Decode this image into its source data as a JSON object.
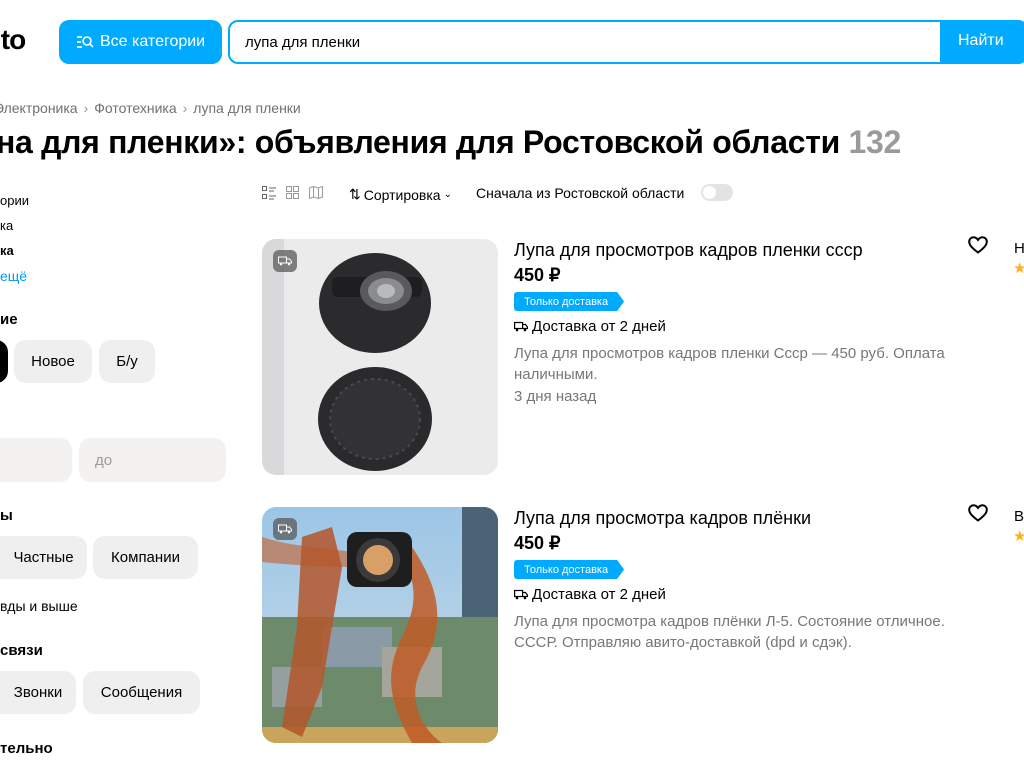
{
  "header": {
    "logo_text": "ito",
    "categories_label": "Все категории",
    "search_value": "лупа для пленки",
    "search_button": "Найти",
    "accent_color": "#00aaff"
  },
  "breadcrumbs": [
    "Электроника",
    "Фототехника",
    "лупа для пленки"
  ],
  "page_title": {
    "text": "на для пленки»: объявления для Ростовской области",
    "count": "132"
  },
  "sidebar": {
    "category_lines": [
      "ории",
      "ка",
      "ка"
    ],
    "show_more": "ещё",
    "condition_heading": "ие",
    "condition_chips": [
      "Новое",
      "Б/у"
    ],
    "price_to_placeholder": "до",
    "sellers_heading": "ы",
    "seller_chips": [
      "Частные",
      "Компании"
    ],
    "rating_text": "вды и выше",
    "contact_heading": "связи",
    "contact_chips": [
      "Звонки",
      "Сообщения"
    ],
    "bottom_heading": "тельно"
  },
  "toolbar": {
    "sort_label": "Сортировка",
    "region_label": "Сначала из Ростовской области",
    "icons": [
      "list-view-icon",
      "grid-view-icon",
      "map-view-icon"
    ]
  },
  "listings": [
    {
      "title": "Лупа для просмотров кадров пленки ссср",
      "price": "450 ₽",
      "badge": "Только доставка",
      "delivery": "Доставка от 2 дней",
      "description": "Лупа для просмотров кадров пленки Ссср — 450 руб. Оплата наличными.",
      "date": "3 дня назад",
      "seller_initial": "Н"
    },
    {
      "title": "Лупа для просмотра кадров плёнки",
      "price": "450 ₽",
      "badge": "Только доставка",
      "delivery": "Доставка от 2 дней",
      "description": "Лупа для просмотра кадров плёнки Л-5. Состояние отличное. СССР. Отправляю авито-доставкой (dpd и сдэк).",
      "date": "",
      "seller_initial": "В"
    }
  ]
}
